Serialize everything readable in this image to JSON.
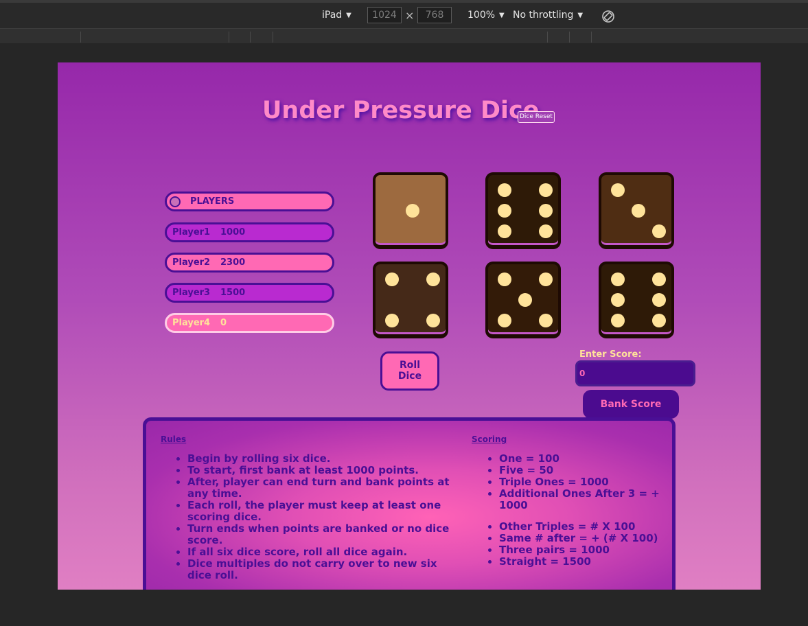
{
  "devtools": {
    "device": "iPad",
    "width": "1024",
    "height": "768",
    "times": "×",
    "zoom": "100%",
    "throttling": "No throttling"
  },
  "game": {
    "title": "Under Pressure Dice",
    "dice_reset_label": "Dice Reset",
    "players_header": "PLAYERS",
    "players": [
      {
        "name": "Player1",
        "score": "1000"
      },
      {
        "name": "Player2",
        "score": "2300"
      },
      {
        "name": "Player3",
        "score": "1500"
      },
      {
        "name": "Player4",
        "score": "0"
      }
    ],
    "active_player": "Player4",
    "dice": [
      {
        "value": 1,
        "color": "#9d6a3f"
      },
      {
        "value": 6,
        "color": "#2e1a07"
      },
      {
        "value": 3,
        "color": "#4f2d13"
      },
      {
        "value": 4,
        "color": "#452918"
      },
      {
        "value": 5,
        "color": "#331b08"
      },
      {
        "value": 6,
        "color": "#2e1a07"
      }
    ],
    "roll_button_line1": "Roll",
    "roll_button_line2": "Dice",
    "enter_score_label": "Enter Score:",
    "score_value": "0",
    "bank_button_label": "Bank Score"
  },
  "rules": {
    "heading": "Rules",
    "items": [
      "Begin by rolling six dice.",
      "To start, first bank at least 1000 points.",
      "After, player can end turn and bank points at any time.",
      "Each roll, the player must keep at least one scoring dice.",
      "Turn ends when points are banked or no dice score.",
      "If all six dice score, roll all dice again.",
      "Dice multiples do not carry over to new six dice roll."
    ]
  },
  "scoring": {
    "heading": "Scoring",
    "items": [
      "One = 100",
      "Five = 50",
      "Triple Ones = 1000",
      "Additional Ones After 3 = + 1000",
      "Other Triples = # X 100",
      "Same # after = + (# X 100)",
      "Three pairs = 1000",
      "Straight = 1500"
    ]
  },
  "colors": {
    "accent_pink": "#ff69b4",
    "accent_purple": "#4a0f95",
    "pip": "#ffe39a"
  }
}
